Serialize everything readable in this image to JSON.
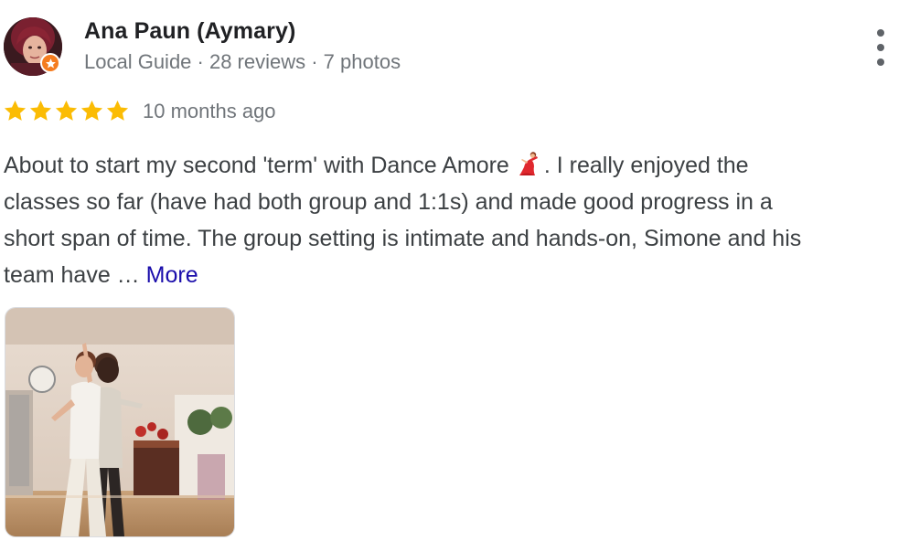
{
  "review": {
    "author": {
      "name": "Ana Paun (Aymary)",
      "meta": "Local Guide · 28 reviews · 7 photos",
      "avatar_icon": "user-avatar",
      "badge_icon": "local-guide-star-icon"
    },
    "rating": {
      "stars": 5,
      "max": 5,
      "star_color": "#fbbc04"
    },
    "time_ago": "10 months ago",
    "text_lines": [
      "About to start my second 'term' with Dance Amore",
      ". I really enjoyed the",
      "classes so far (have had both group and 1:1s) and made good progress in a",
      "short span of time. The group setting is intimate and hands-on, Simone and his",
      "team have … "
    ],
    "emoji_icon": "woman-dancing-emoji",
    "more_label": "More",
    "more_color": "#1a0dab",
    "menu_icon": "more-vertical-icon",
    "photo_icon": "review-photo-dancing-couple"
  }
}
